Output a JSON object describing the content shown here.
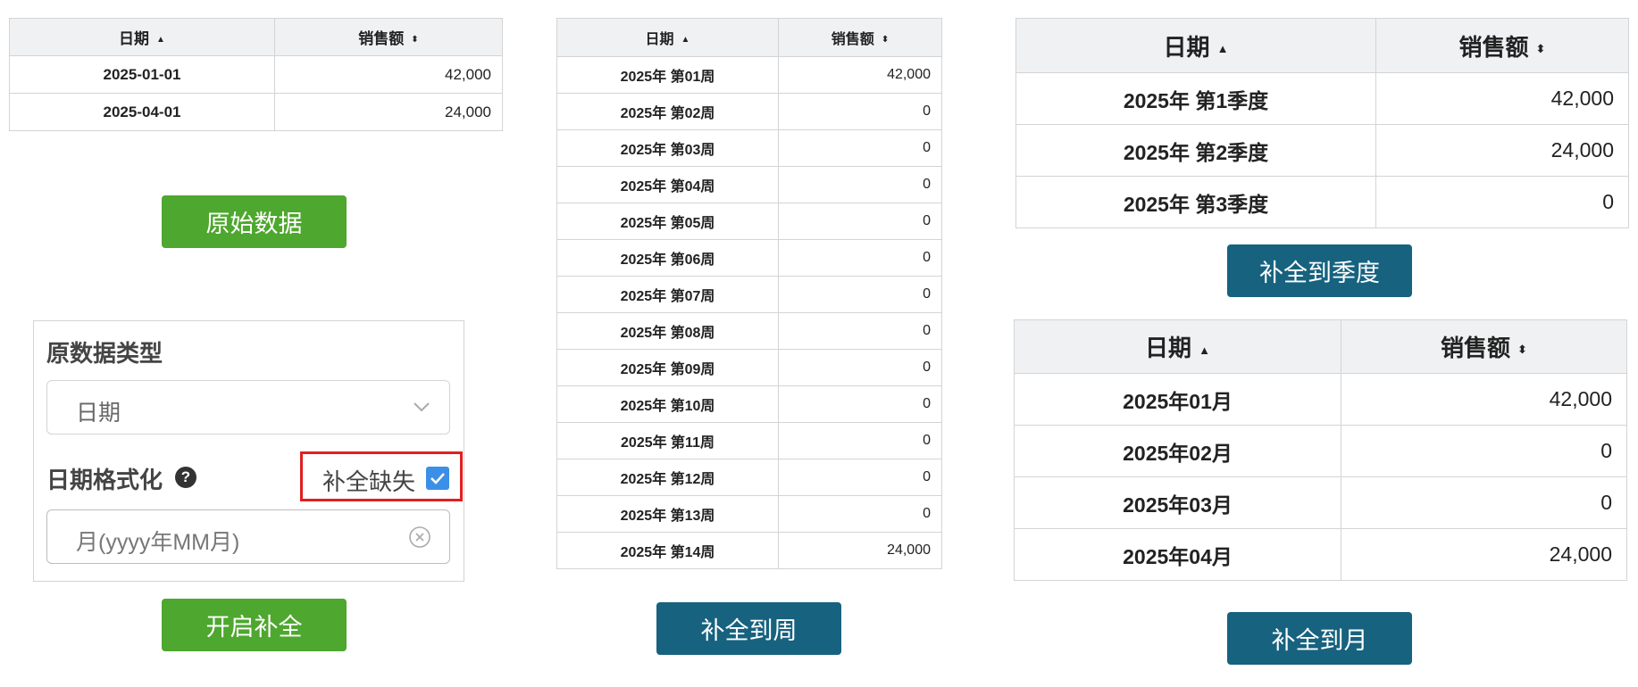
{
  "colors": {
    "green": "#4ea72e",
    "blue": "#17627f",
    "highlight": "#e02020",
    "checkbox": "#3c8fe6"
  },
  "columns": {
    "date": "日期",
    "sales": "销售额"
  },
  "raw_table": {
    "rows": [
      {
        "date": "2025-01-01",
        "amount": "42,000"
      },
      {
        "date": "2025-04-01",
        "amount": "24,000"
      }
    ]
  },
  "week_table": {
    "rows": [
      {
        "date": "2025年 第01周",
        "amount": "42,000"
      },
      {
        "date": "2025年 第02周",
        "amount": "0"
      },
      {
        "date": "2025年 第03周",
        "amount": "0"
      },
      {
        "date": "2025年 第04周",
        "amount": "0"
      },
      {
        "date": "2025年 第05周",
        "amount": "0"
      },
      {
        "date": "2025年 第06周",
        "amount": "0"
      },
      {
        "date": "2025年 第07周",
        "amount": "0"
      },
      {
        "date": "2025年 第08周",
        "amount": "0"
      },
      {
        "date": "2025年 第09周",
        "amount": "0"
      },
      {
        "date": "2025年 第10周",
        "amount": "0"
      },
      {
        "date": "2025年 第11周",
        "amount": "0"
      },
      {
        "date": "2025年 第12周",
        "amount": "0"
      },
      {
        "date": "2025年 第13周",
        "amount": "0"
      },
      {
        "date": "2025年 第14周",
        "amount": "24,000"
      }
    ]
  },
  "quarter_table": {
    "rows": [
      {
        "date": "2025年 第1季度",
        "amount": "42,000"
      },
      {
        "date": "2025年 第2季度",
        "amount": "24,000"
      },
      {
        "date": "2025年 第3季度",
        "amount": "0"
      }
    ]
  },
  "month_table": {
    "rows": [
      {
        "date": "2025年01月",
        "amount": "42,000"
      },
      {
        "date": "2025年02月",
        "amount": "0"
      },
      {
        "date": "2025年03月",
        "amount": "0"
      },
      {
        "date": "2025年04月",
        "amount": "24,000"
      }
    ]
  },
  "buttons": {
    "raw": "原始数据",
    "enable_fill": "开启补全",
    "fill_week": "补全到周",
    "fill_quarter": "补全到季度",
    "fill_month": "补全到月"
  },
  "panel": {
    "type_label": "原数据类型",
    "type_value": "日期",
    "format_label": "日期格式化",
    "help_glyph": "?",
    "fill_missing_label": "补全缺失",
    "fill_missing_checked": true,
    "format_value": "月(yyyy年MM月)"
  }
}
